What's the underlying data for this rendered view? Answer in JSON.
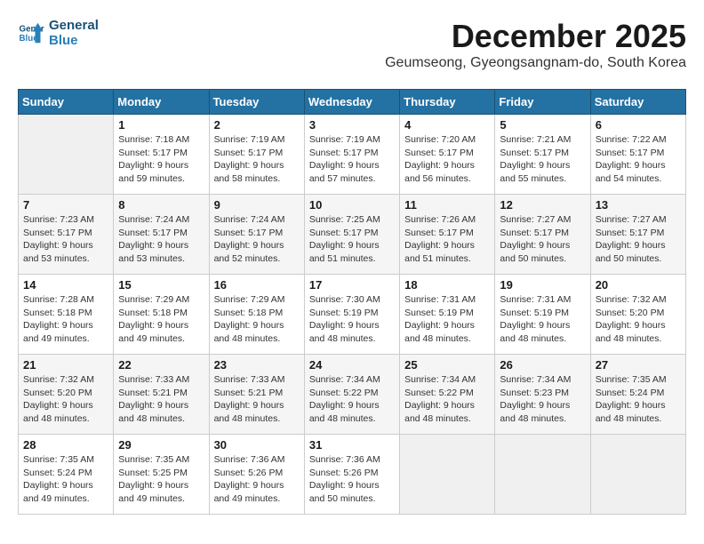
{
  "header": {
    "logo_line1": "General",
    "logo_line2": "Blue",
    "title": "December 2025",
    "subtitle": "Geumseong, Gyeongsangnam-do, South Korea"
  },
  "weekdays": [
    "Sunday",
    "Monday",
    "Tuesday",
    "Wednesday",
    "Thursday",
    "Friday",
    "Saturday"
  ],
  "weeks": [
    [
      {
        "day": "",
        "info": ""
      },
      {
        "day": "1",
        "info": "Sunrise: 7:18 AM\nSunset: 5:17 PM\nDaylight: 9 hours\nand 59 minutes."
      },
      {
        "day": "2",
        "info": "Sunrise: 7:19 AM\nSunset: 5:17 PM\nDaylight: 9 hours\nand 58 minutes."
      },
      {
        "day": "3",
        "info": "Sunrise: 7:19 AM\nSunset: 5:17 PM\nDaylight: 9 hours\nand 57 minutes."
      },
      {
        "day": "4",
        "info": "Sunrise: 7:20 AM\nSunset: 5:17 PM\nDaylight: 9 hours\nand 56 minutes."
      },
      {
        "day": "5",
        "info": "Sunrise: 7:21 AM\nSunset: 5:17 PM\nDaylight: 9 hours\nand 55 minutes."
      },
      {
        "day": "6",
        "info": "Sunrise: 7:22 AM\nSunset: 5:17 PM\nDaylight: 9 hours\nand 54 minutes."
      }
    ],
    [
      {
        "day": "7",
        "info": "Sunrise: 7:23 AM\nSunset: 5:17 PM\nDaylight: 9 hours\nand 53 minutes."
      },
      {
        "day": "8",
        "info": "Sunrise: 7:24 AM\nSunset: 5:17 PM\nDaylight: 9 hours\nand 53 minutes."
      },
      {
        "day": "9",
        "info": "Sunrise: 7:24 AM\nSunset: 5:17 PM\nDaylight: 9 hours\nand 52 minutes."
      },
      {
        "day": "10",
        "info": "Sunrise: 7:25 AM\nSunset: 5:17 PM\nDaylight: 9 hours\nand 51 minutes."
      },
      {
        "day": "11",
        "info": "Sunrise: 7:26 AM\nSunset: 5:17 PM\nDaylight: 9 hours\nand 51 minutes."
      },
      {
        "day": "12",
        "info": "Sunrise: 7:27 AM\nSunset: 5:17 PM\nDaylight: 9 hours\nand 50 minutes."
      },
      {
        "day": "13",
        "info": "Sunrise: 7:27 AM\nSunset: 5:17 PM\nDaylight: 9 hours\nand 50 minutes."
      }
    ],
    [
      {
        "day": "14",
        "info": "Sunrise: 7:28 AM\nSunset: 5:18 PM\nDaylight: 9 hours\nand 49 minutes."
      },
      {
        "day": "15",
        "info": "Sunrise: 7:29 AM\nSunset: 5:18 PM\nDaylight: 9 hours\nand 49 minutes."
      },
      {
        "day": "16",
        "info": "Sunrise: 7:29 AM\nSunset: 5:18 PM\nDaylight: 9 hours\nand 48 minutes."
      },
      {
        "day": "17",
        "info": "Sunrise: 7:30 AM\nSunset: 5:19 PM\nDaylight: 9 hours\nand 48 minutes."
      },
      {
        "day": "18",
        "info": "Sunrise: 7:31 AM\nSunset: 5:19 PM\nDaylight: 9 hours\nand 48 minutes."
      },
      {
        "day": "19",
        "info": "Sunrise: 7:31 AM\nSunset: 5:19 PM\nDaylight: 9 hours\nand 48 minutes."
      },
      {
        "day": "20",
        "info": "Sunrise: 7:32 AM\nSunset: 5:20 PM\nDaylight: 9 hours\nand 48 minutes."
      }
    ],
    [
      {
        "day": "21",
        "info": "Sunrise: 7:32 AM\nSunset: 5:20 PM\nDaylight: 9 hours\nand 48 minutes."
      },
      {
        "day": "22",
        "info": "Sunrise: 7:33 AM\nSunset: 5:21 PM\nDaylight: 9 hours\nand 48 minutes."
      },
      {
        "day": "23",
        "info": "Sunrise: 7:33 AM\nSunset: 5:21 PM\nDaylight: 9 hours\nand 48 minutes."
      },
      {
        "day": "24",
        "info": "Sunrise: 7:34 AM\nSunset: 5:22 PM\nDaylight: 9 hours\nand 48 minutes."
      },
      {
        "day": "25",
        "info": "Sunrise: 7:34 AM\nSunset: 5:22 PM\nDaylight: 9 hours\nand 48 minutes."
      },
      {
        "day": "26",
        "info": "Sunrise: 7:34 AM\nSunset: 5:23 PM\nDaylight: 9 hours\nand 48 minutes."
      },
      {
        "day": "27",
        "info": "Sunrise: 7:35 AM\nSunset: 5:24 PM\nDaylight: 9 hours\nand 48 minutes."
      }
    ],
    [
      {
        "day": "28",
        "info": "Sunrise: 7:35 AM\nSunset: 5:24 PM\nDaylight: 9 hours\nand 49 minutes."
      },
      {
        "day": "29",
        "info": "Sunrise: 7:35 AM\nSunset: 5:25 PM\nDaylight: 9 hours\nand 49 minutes."
      },
      {
        "day": "30",
        "info": "Sunrise: 7:36 AM\nSunset: 5:26 PM\nDaylight: 9 hours\nand 49 minutes."
      },
      {
        "day": "31",
        "info": "Sunrise: 7:36 AM\nSunset: 5:26 PM\nDaylight: 9 hours\nand 50 minutes."
      },
      {
        "day": "",
        "info": ""
      },
      {
        "day": "",
        "info": ""
      },
      {
        "day": "",
        "info": ""
      }
    ]
  ]
}
